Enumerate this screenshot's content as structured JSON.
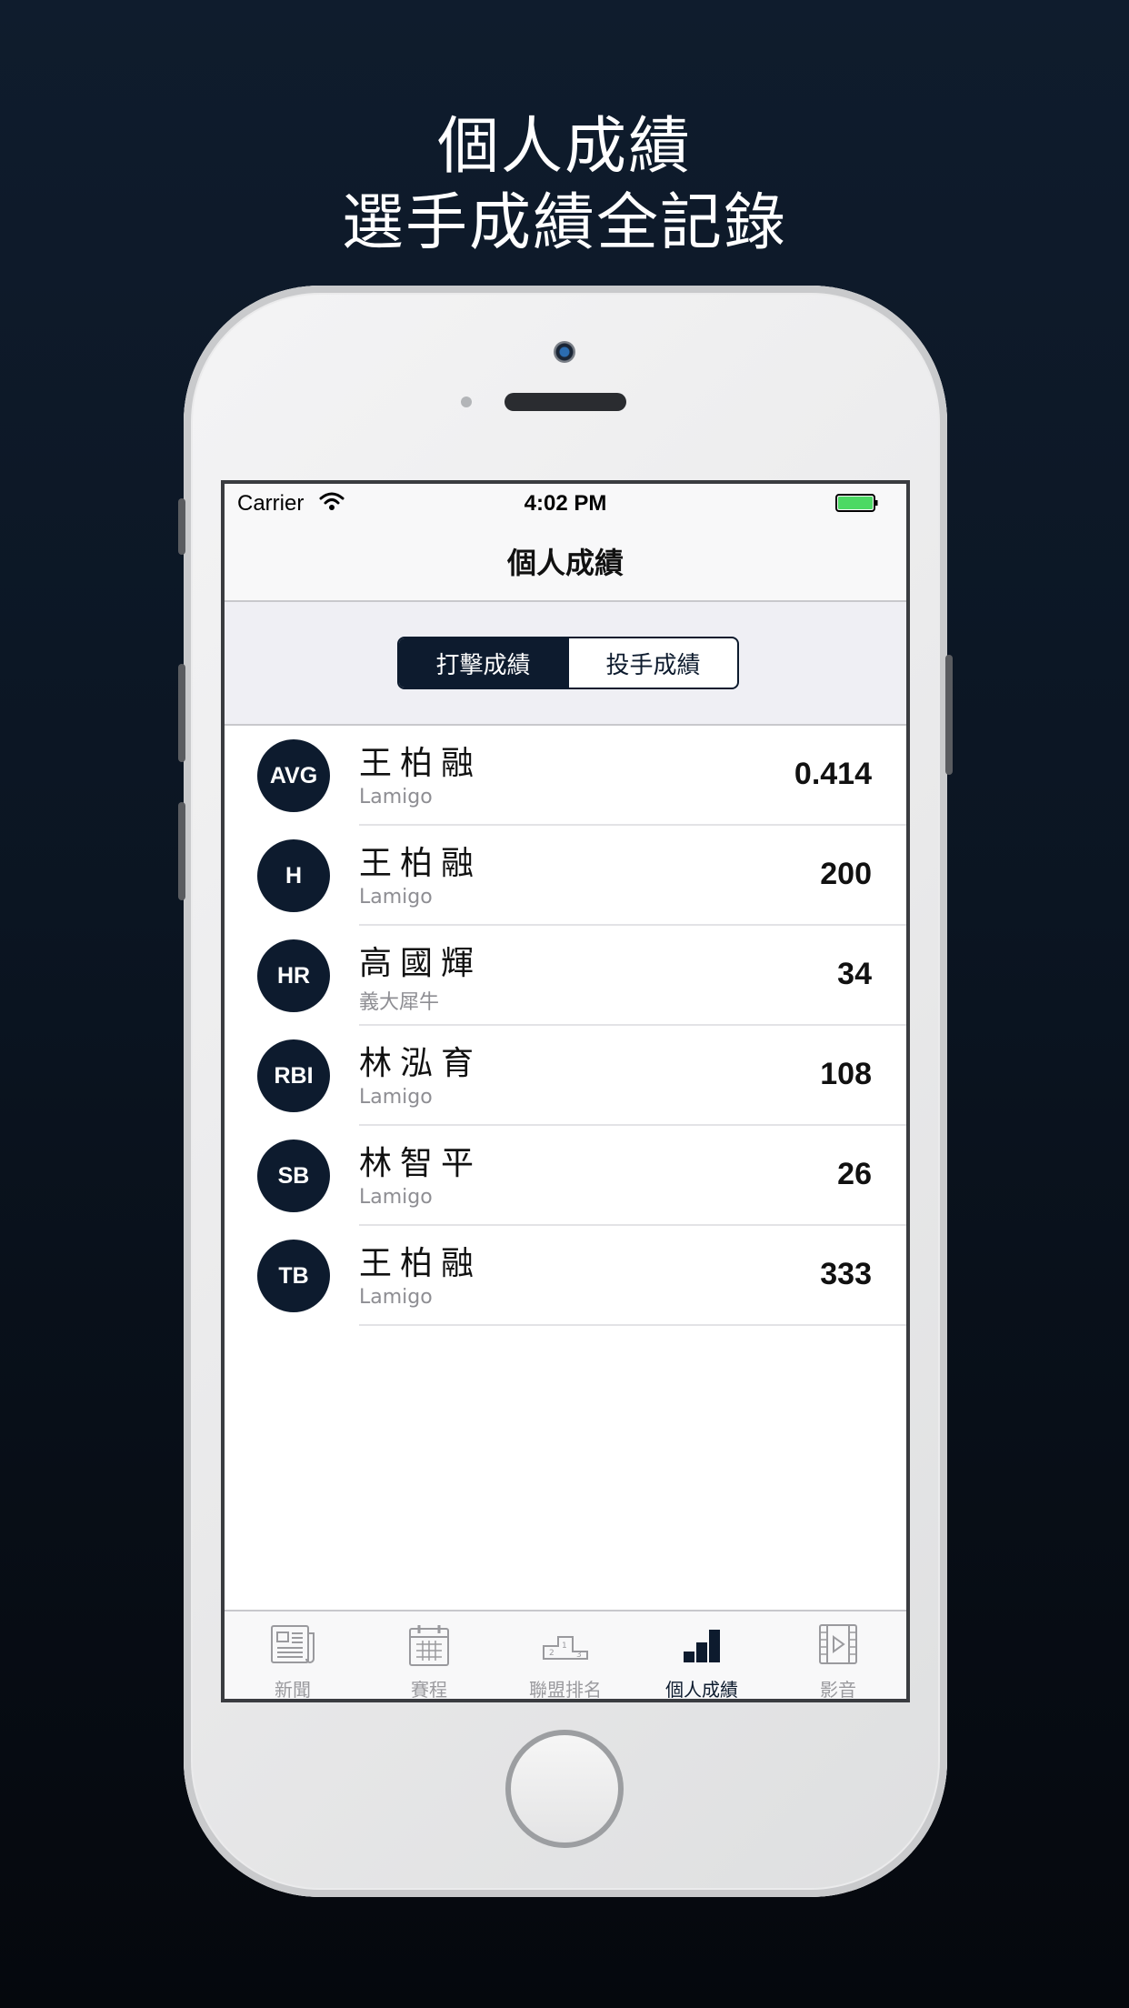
{
  "promo": {
    "line1": "個人成績",
    "line2": "選手成績全記錄"
  },
  "status_bar": {
    "carrier": "Carrier",
    "time": "4:02 PM",
    "battery_color": "#4cd964"
  },
  "nav": {
    "title": "個人成績"
  },
  "segments": [
    {
      "label": "打擊成績",
      "selected": true
    },
    {
      "label": "投手成績",
      "selected": false
    }
  ],
  "stats": [
    {
      "badge": "AVG",
      "player": "王柏融",
      "team": "Lamigo",
      "value": "0.414"
    },
    {
      "badge": "H",
      "player": "王柏融",
      "team": "Lamigo",
      "value": "200"
    },
    {
      "badge": "HR",
      "player": "高國輝",
      "team": "義大犀牛",
      "value": "34"
    },
    {
      "badge": "RBI",
      "player": "林泓育",
      "team": "Lamigo",
      "value": "108"
    },
    {
      "badge": "SB",
      "player": "林智平",
      "team": "Lamigo",
      "value": "26"
    },
    {
      "badge": "TB",
      "player": "王柏融",
      "team": "Lamigo",
      "value": "333"
    }
  ],
  "tabs": [
    {
      "label": "新聞",
      "icon": "newspaper-icon",
      "active": false
    },
    {
      "label": "賽程",
      "icon": "calendar-icon",
      "active": false
    },
    {
      "label": "聯盟排名",
      "icon": "podium-icon",
      "active": false
    },
    {
      "label": "個人成績",
      "icon": "bar-chart-icon",
      "active": true
    },
    {
      "label": "影音",
      "icon": "film-icon",
      "active": false
    }
  ],
  "colors": {
    "accent": "#0d1b2e",
    "inactive_tab": "#9a9a9e",
    "background_top": "#0f1c2d"
  }
}
